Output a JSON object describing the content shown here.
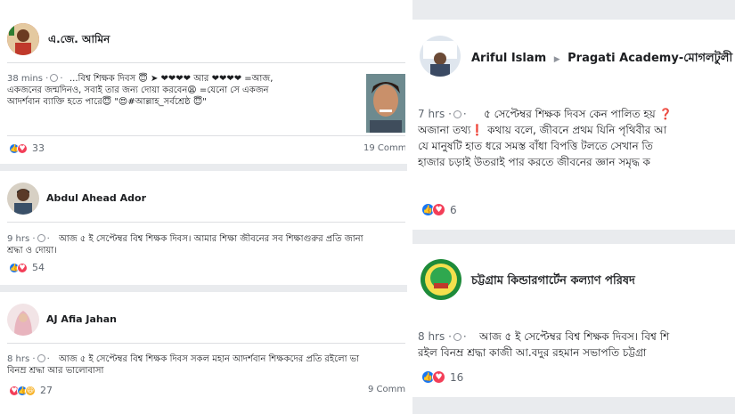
{
  "left": {
    "posts": [
      {
        "author": "এ.জে. আমিন",
        "time": "38 mins",
        "text_line1": "...বিশ্ব শিক্ষক দিবস 😇 ➤ ❤❤❤❤ আর ❤❤❤❤ =আজ,",
        "text_line2": "একজনের জন্মদিনও, সবাই তার জন্য দোয়া করবেন😩 =যেনো সে একজন",
        "text_line3": "আদর্শবান ব্যাক্তি হতে পারে😇 \"😍#আল্লাহ_সর্বশ্রেষ্ঠ 😇\"",
        "reaction_count": "33",
        "comments": "19 Comm"
      },
      {
        "author": "Abdul Ahead Ador",
        "time": "9 hrs",
        "text_line1": "আজ ৫ ই সেপ্টেম্বর বিশ্ব শিক্ষক দিবস। আমার শিক্ষা জীবনের সব শিক্ষাগুরুর প্রতি জানা",
        "text_line2": "শ্রদ্ধা ও দোয়া।",
        "reaction_count": "54"
      },
      {
        "author": "AJ Afia Jahan",
        "time": "8 hrs",
        "text_line1": "আজ ৫ ই সেপ্টেম্বর বিশ্ব শিক্ষক দিবস সকল মহান আদর্শবান শিক্ষকদের প্রতি রইলো ভা",
        "text_line2": "বিনম্র শ্রদ্ধা আর ভালোবাসা",
        "reaction_count": "27",
        "comments": "9 Comm"
      }
    ]
  },
  "right": {
    "posts": [
      {
        "author": "Ariful Islam",
        "separator": "▶",
        "group": "Pragati Academy-মোগলটুলী",
        "time": "7 hrs",
        "text_line1": "৫ সেপ্টেম্বর শিক্ষক দিবস কেন পালিত হয় ❓",
        "text_line2": "অজানা তথ্য❗ কথায় বলে, জীবনে প্রথম যিনি পৃথিবীর আ",
        "text_line3": "যে মানুষটি হাত ধরে সমস্ত বাঁধা বিপত্তি টলতে সেখান তি",
        "text_line4": "হাজার চড়াই উতরাই পার করতে জীবনের জ্ঞান সমৃদ্ধ ক",
        "reaction_count": "6"
      },
      {
        "author": "চট্টগ্রাম কিন্ডারগার্টেন কল্যাণ পরিষদ",
        "time": "8 hrs",
        "text_line1": "আজ ৫ ই সেপ্টেম্বর বিশ্ব শিক্ষক দিবস। বিশ্ব শি",
        "text_line2": "রইল বিনম্র শ্রদ্ধা কাজী আ.বদুর রহমান সভাপতি চট্টগ্রা",
        "reaction_count": "16"
      }
    ]
  },
  "icons": {
    "like": "👍",
    "love": "♥",
    "haha": "😆"
  },
  "colors": {
    "like": "#1877f2",
    "love": "#f33e58",
    "separator": "#e9ebee",
    "meta_text": "#606770"
  }
}
